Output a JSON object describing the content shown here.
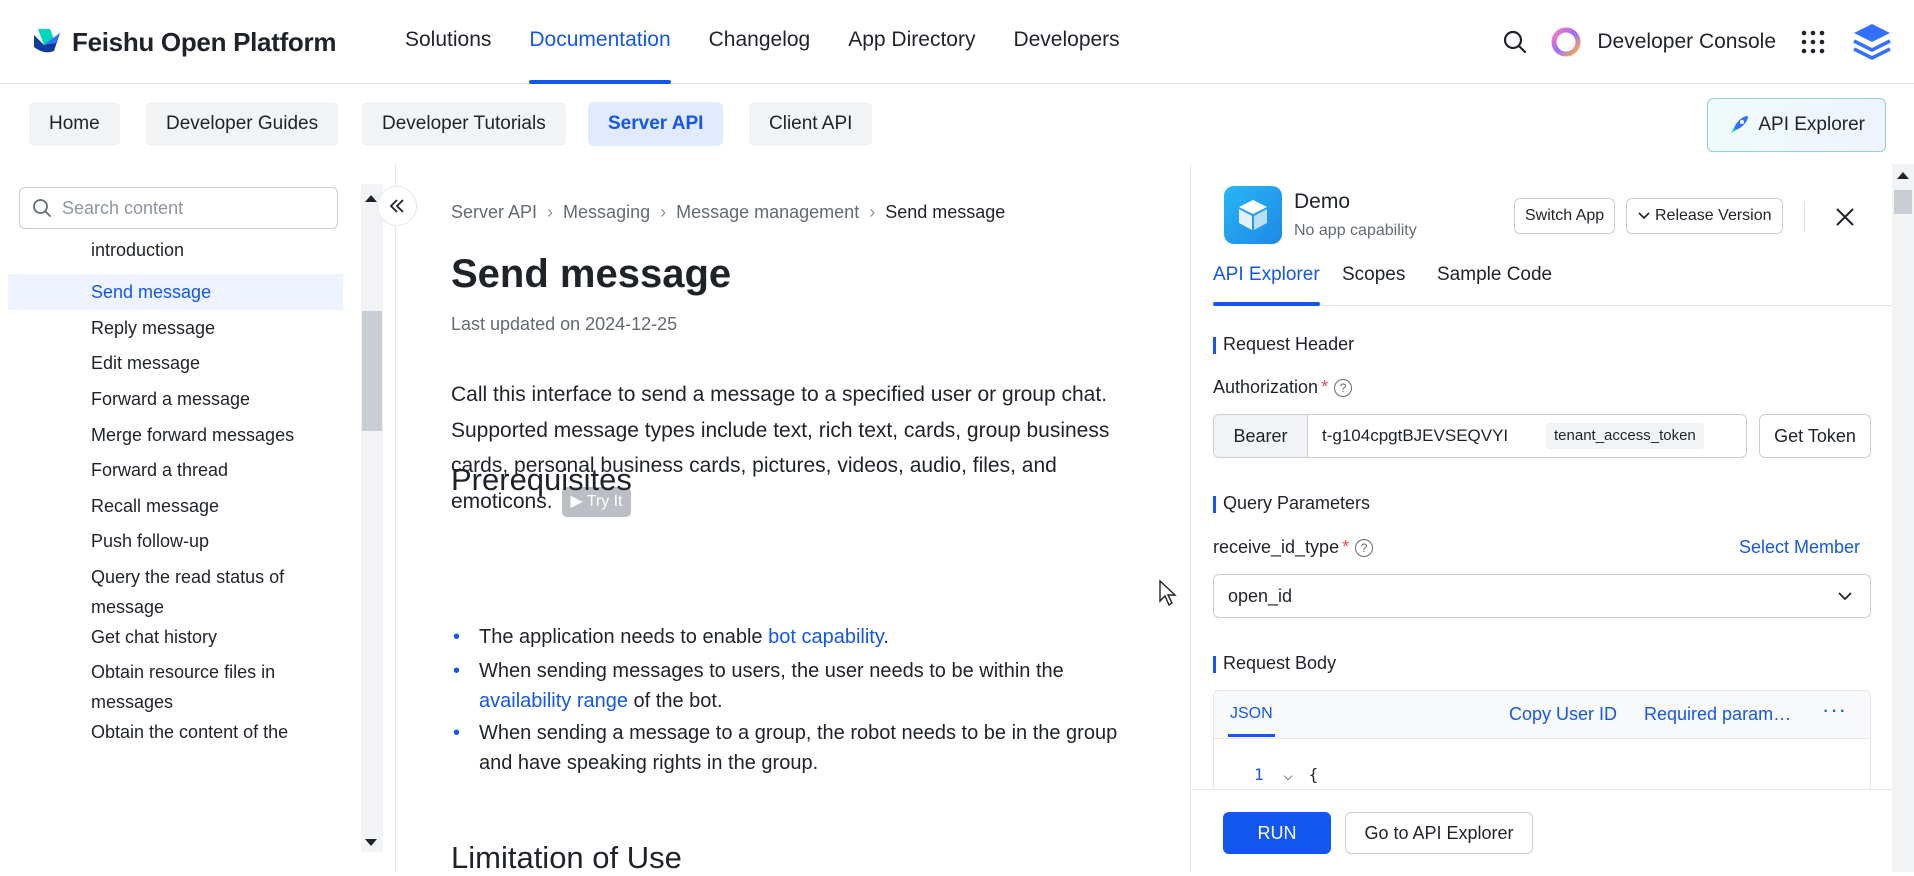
{
  "header": {
    "brand": "Feishu Open Platform",
    "nav": [
      "Solutions",
      "Documentation",
      "Changelog",
      "App Directory",
      "Developers"
    ],
    "developer_console": "Developer Console"
  },
  "subnav": {
    "items": [
      "Home",
      "Developer Guides",
      "Developer Tutorials",
      "Server API",
      "Client API"
    ],
    "active": "Server API",
    "api_explorer": "API Explorer"
  },
  "sidebar": {
    "search_placeholder": "Search content",
    "items": [
      "introduction",
      "Send message",
      "Reply message",
      "Edit message",
      "Forward a message",
      "Merge forward messages",
      "Forward a thread",
      "Recall message",
      "Push follow-up",
      "Query the read status of message",
      "Get chat history",
      "Obtain resource files in messages",
      "Obtain the content of the"
    ]
  },
  "content": {
    "breadcrumb": [
      "Server API",
      "Messaging",
      "Message management",
      "Send message"
    ],
    "title": "Send message",
    "updated": "Last updated on 2024-12-25",
    "description": "Call this interface to send a message to a specified user or group chat. Supported message types include text, rich text, cards, group business cards, personal business cards, pictures, videos, audio, files, and emoticons.",
    "try_it": "Try It",
    "prerequisites_title": "Prerequisites",
    "bullets": [
      {
        "before": "The application needs to enable ",
        "link": "bot capability",
        "after": "."
      },
      {
        "before": "When sending messages to users, the user needs to be within the ",
        "link": "availability range",
        "after": " of the bot."
      },
      {
        "before": "When sending a message to a group, the robot needs to be in the group and have speaking rights in the group.",
        "link": "",
        "after": ""
      }
    ],
    "limitation_title": "Limitation of Use"
  },
  "panel": {
    "app_name": "Demo",
    "app_sub": "No app capability",
    "switch_app": "Switch App",
    "release_version": "Release Version",
    "tabs": [
      "API Explorer",
      "Scopes",
      "Sample Code"
    ],
    "request_header": "Request Header",
    "authorization": "Authorization",
    "bearer": "Bearer",
    "token_value": "t-g104cpgtBJEVSEQVYI",
    "token_type": "tenant_access_token",
    "get_token": "Get Token",
    "query_params": "Query Parameters",
    "receive_id_type": "receive_id_type",
    "select_member": "Select Member",
    "receive_id_value": "open_id",
    "request_body": "Request Body",
    "json_tab": "JSON",
    "copy_user_id": "Copy User ID",
    "required_params": "Required param…",
    "code_line_no": "1",
    "code_text": "{",
    "run": "RUN",
    "go_to_explorer": "Go to API Explorer"
  },
  "colors": {
    "accent": "#1456f0",
    "required": "#f54a45"
  }
}
